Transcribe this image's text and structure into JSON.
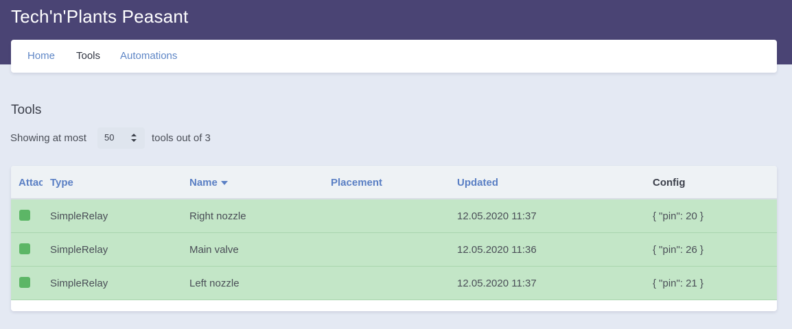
{
  "app": {
    "title": "Tech'n'Plants Peasant"
  },
  "nav": {
    "items": [
      {
        "label": "Home"
      },
      {
        "label": "Tools"
      },
      {
        "label": "Automations"
      }
    ],
    "active": "Tools"
  },
  "page": {
    "heading": "Tools",
    "showing_prefix": "Showing at most",
    "limit": "50",
    "showing_suffix": "tools out of 3"
  },
  "table": {
    "columns": [
      "Attac",
      "Type",
      "Name",
      "Placement",
      "Updated",
      "Config"
    ],
    "sort": {
      "column": "Name",
      "direction": "desc"
    },
    "rows": [
      {
        "attached": true,
        "type": "SimpleRelay",
        "name": "Right nozzle",
        "placement": "",
        "updated": "12.05.2020 11:37",
        "config": "{ \"pin\": 20 }"
      },
      {
        "attached": true,
        "type": "SimpleRelay",
        "name": "Main valve",
        "placement": "",
        "updated": "12.05.2020 11:36",
        "config": "{ \"pin\": 26 }"
      },
      {
        "attached": true,
        "type": "SimpleRelay",
        "name": "Left nozzle",
        "placement": "",
        "updated": "12.05.2020 11:37",
        "config": "{ \"pin\": 21 }"
      }
    ]
  },
  "colors": {
    "header_bg": "#4a4474",
    "row_attached_bg": "#c3e6c7",
    "attached_indicator": "#5cb666",
    "link": "#5e86c6"
  }
}
